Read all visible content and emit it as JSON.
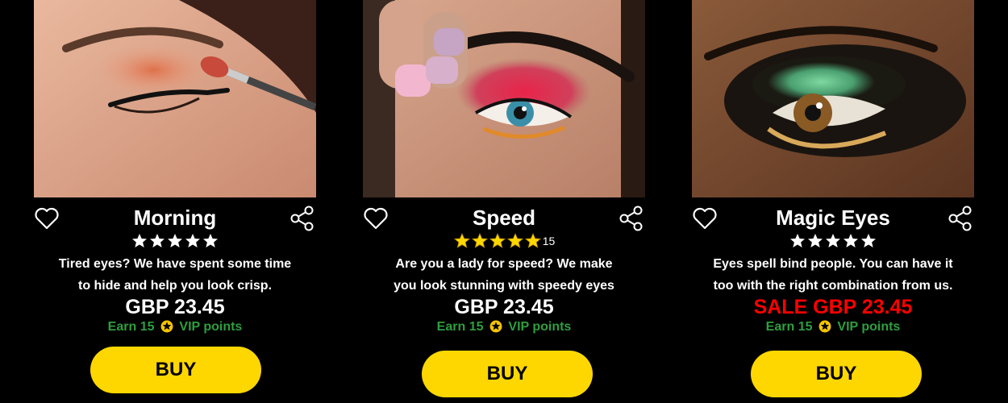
{
  "colors": {
    "background": "#000000",
    "button": "#ffd700",
    "vip_text": "#2e9e3e",
    "sale_price": "#ff0000",
    "rated_star": "#ffd700",
    "star": "#ffffff"
  },
  "products": [
    {
      "title": "Morning",
      "rating": 5,
      "review_count": "",
      "description_line1": "Tired eyes? We have spent some time",
      "description_line2": "to hide and help you look crisp.",
      "price": "GBP 23.45",
      "on_sale": false,
      "vip_prefix": "Earn 15",
      "vip_suffix": "VIP points",
      "buy_label": "BUY",
      "icons": {
        "favorite": "heart-outline-icon",
        "share": "share-icon"
      }
    },
    {
      "title": "Speed",
      "rating": 5,
      "review_count": "15",
      "description_line1": "Are you a lady for speed? We make",
      "description_line2": "you look stunning with speedy eyes",
      "price": "GBP 23.45",
      "on_sale": false,
      "vip_prefix": "Earn 15",
      "vip_suffix": "VIP points",
      "buy_label": "BUY",
      "icons": {
        "favorite": "heart-outline-icon",
        "share": "share-icon"
      }
    },
    {
      "title": "Magic Eyes",
      "rating": 5,
      "review_count": "",
      "description_line1": "Eyes spell bind people. You can have it",
      "description_line2": "too with the right combination from us.",
      "price": "SALE GBP 23.45",
      "on_sale": true,
      "vip_prefix": "Earn 15",
      "vip_suffix": "VIP points",
      "buy_label": "BUY",
      "icons": {
        "favorite": "heart-outline-icon",
        "share": "share-icon"
      }
    }
  ]
}
